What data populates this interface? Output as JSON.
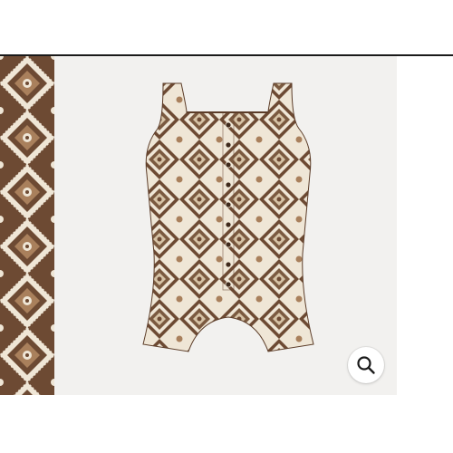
{
  "product": {
    "image_subject": "romper-image",
    "pattern_colors": {
      "dark": "#6d4a33",
      "light": "#efe6d6",
      "accent": "#a9805c"
    },
    "thumbnail_count": 1
  },
  "controls": {
    "zoom_icon": "search-icon"
  },
  "colors": {
    "page_background": "#ffffff",
    "image_background": "#f2f1ef",
    "rule": "#1a1a1a"
  }
}
